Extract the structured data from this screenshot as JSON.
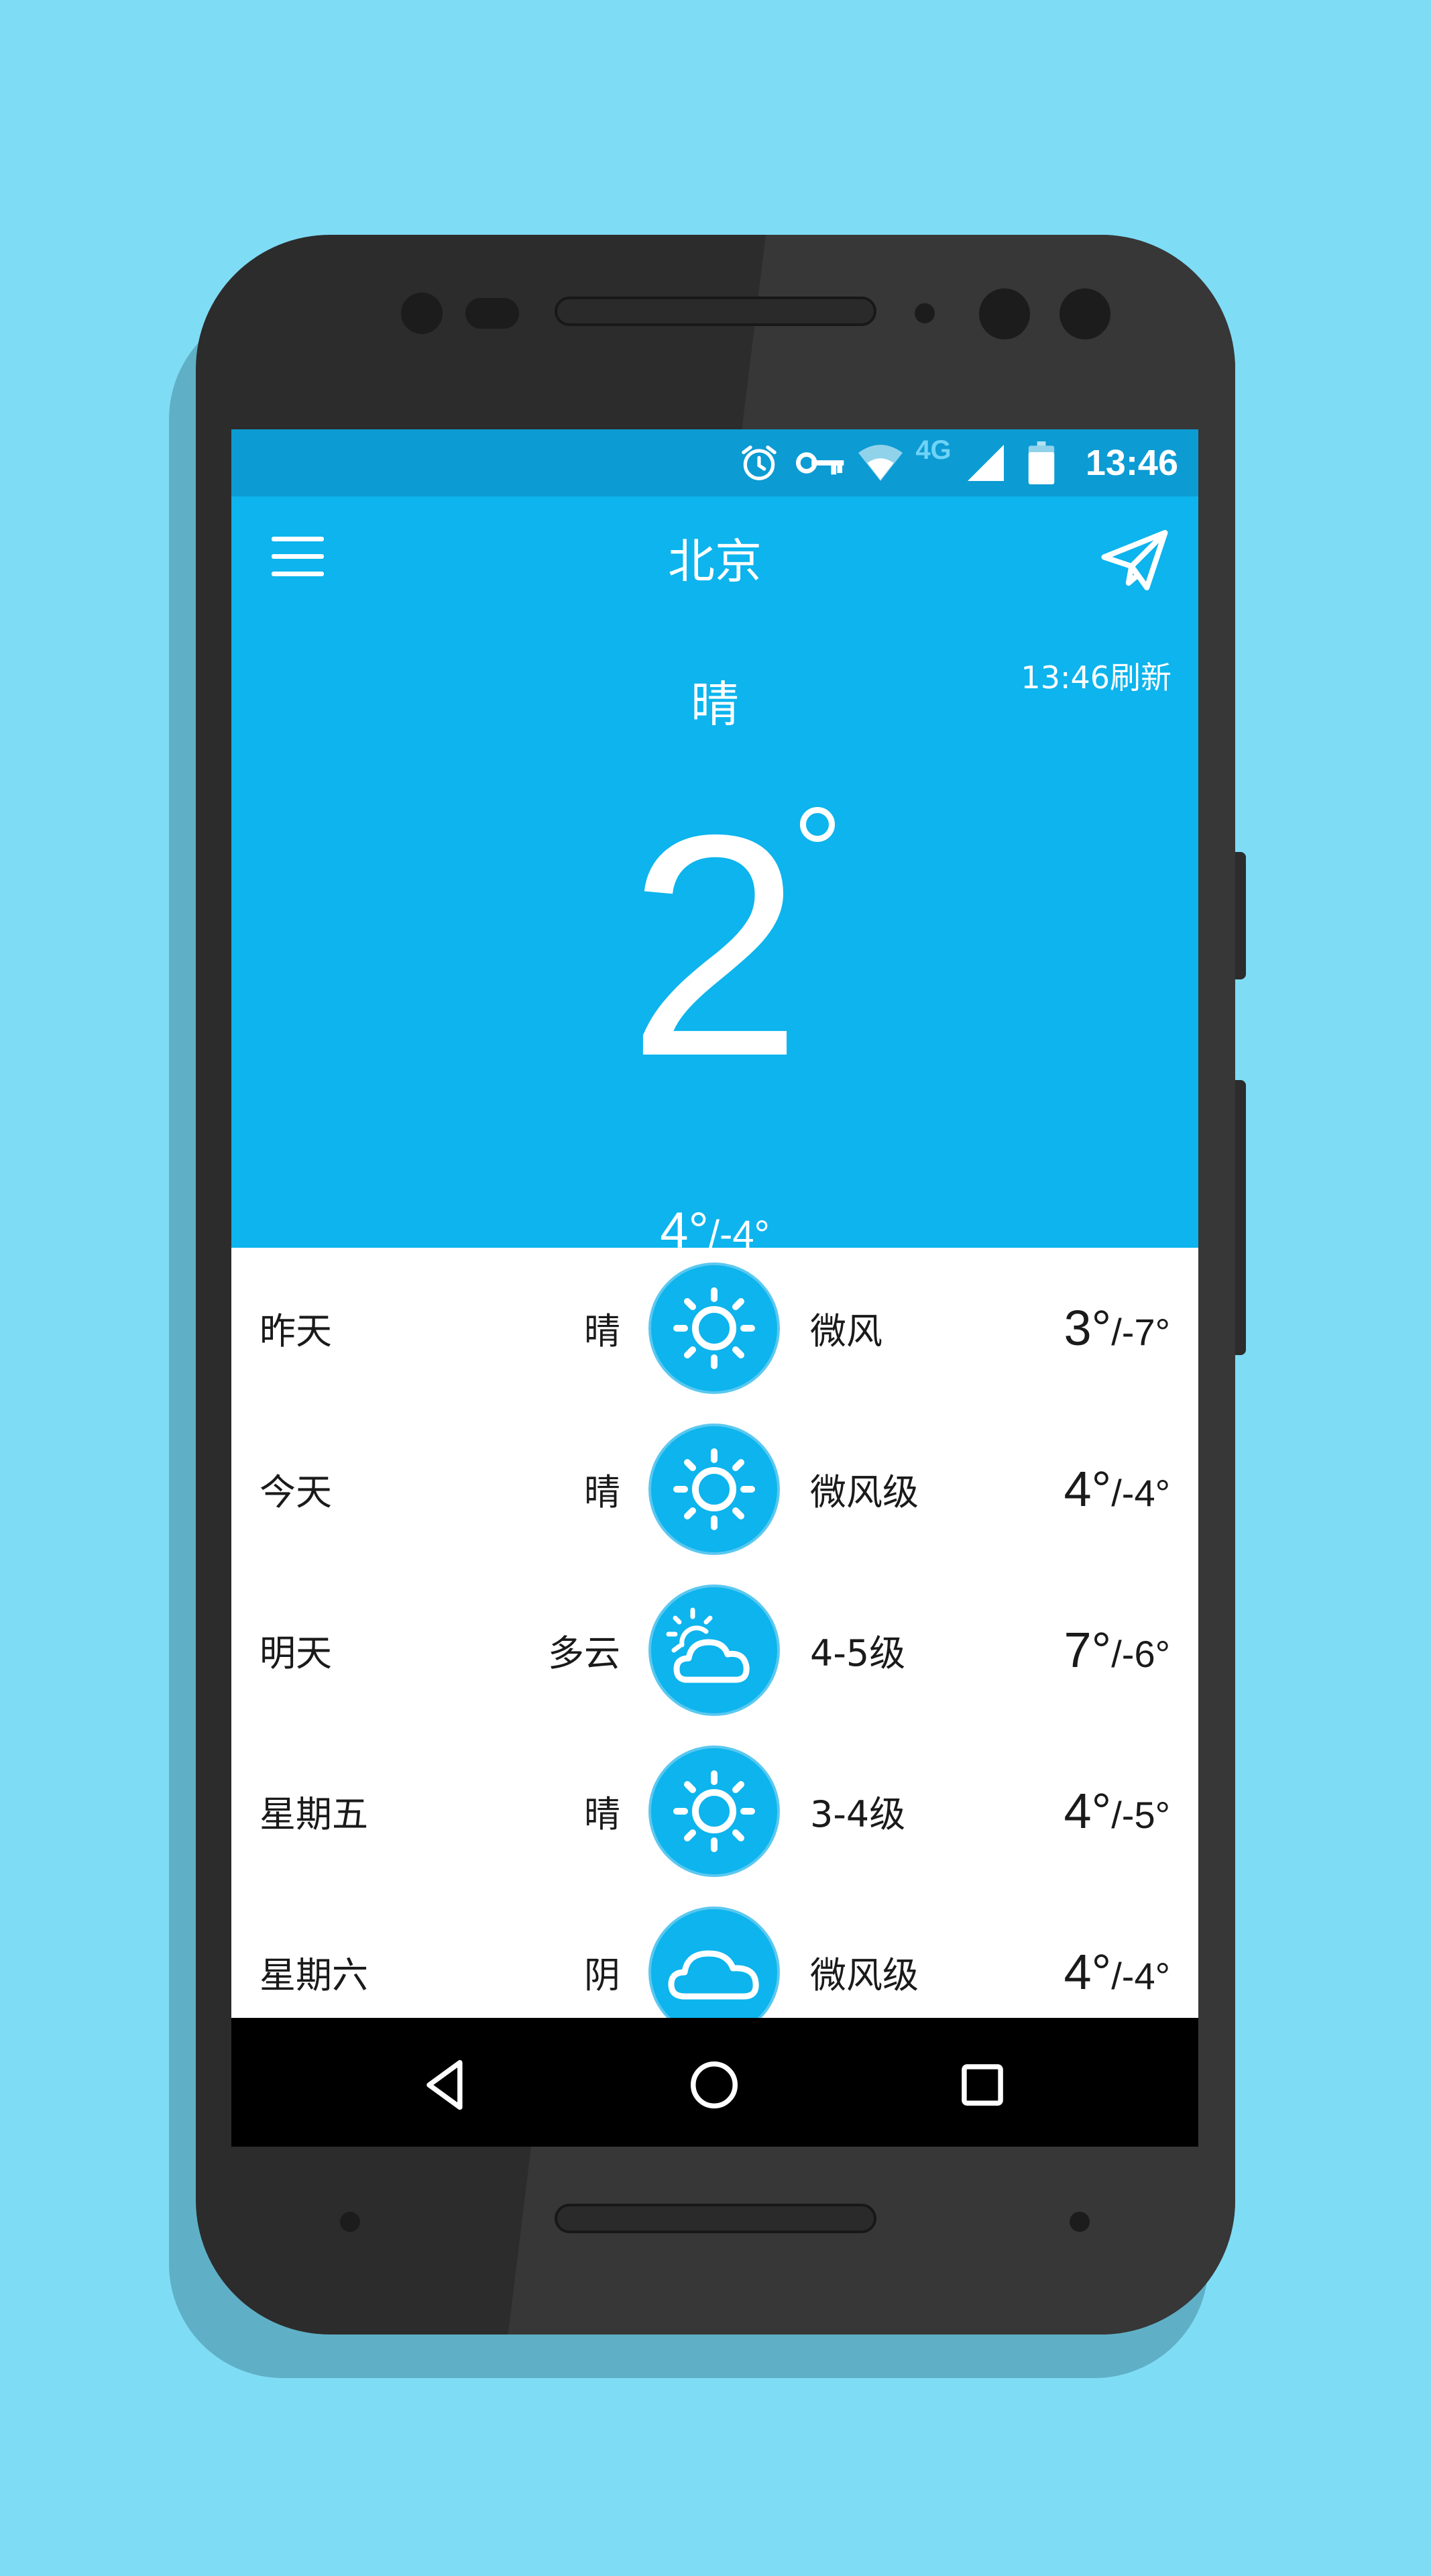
{
  "colors": {
    "background": "#7fdcf5",
    "status_bar": "#0c9bd3",
    "app_bar": "#0db4ed",
    "icon_circle": "#0db4ed",
    "nav_bar": "#000000"
  },
  "status_bar": {
    "icons": [
      "alarm-icon",
      "vpn-key-icon",
      "wifi-icon",
      "network-4g-icon",
      "cell-signal-icon",
      "battery-icon"
    ],
    "network_label": "4G",
    "time": "13:46"
  },
  "app_bar": {
    "menu_icon": "hamburger-menu-icon",
    "city": "北京",
    "share_icon": "send-icon"
  },
  "current": {
    "refresh_time": "13:46刷新",
    "condition": "晴",
    "temperature": "2",
    "high": "4°",
    "low": "/-4°"
  },
  "forecast": [
    {
      "day": "昨天",
      "condition": "晴",
      "icon": "sunny-icon",
      "wind": "微风",
      "high": "3°",
      "low": "/-7°"
    },
    {
      "day": "今天",
      "condition": "晴",
      "icon": "sunny-icon",
      "wind": "微风级",
      "high": "4°",
      "low": "/-4°"
    },
    {
      "day": "明天",
      "condition": "多云",
      "icon": "partly-cloudy-icon",
      "wind": "4-5级",
      "high": "7°",
      "low": "/-6°"
    },
    {
      "day": "星期五",
      "condition": "晴",
      "icon": "sunny-icon",
      "wind": "3-4级",
      "high": "4°",
      "low": "/-5°"
    },
    {
      "day": "星期六",
      "condition": "阴",
      "icon": "cloudy-icon",
      "wind": "微风级",
      "high": "4°",
      "low": "/-4°"
    }
  ],
  "nav_bar": {
    "buttons": [
      "back-icon",
      "home-icon",
      "recents-icon"
    ]
  }
}
